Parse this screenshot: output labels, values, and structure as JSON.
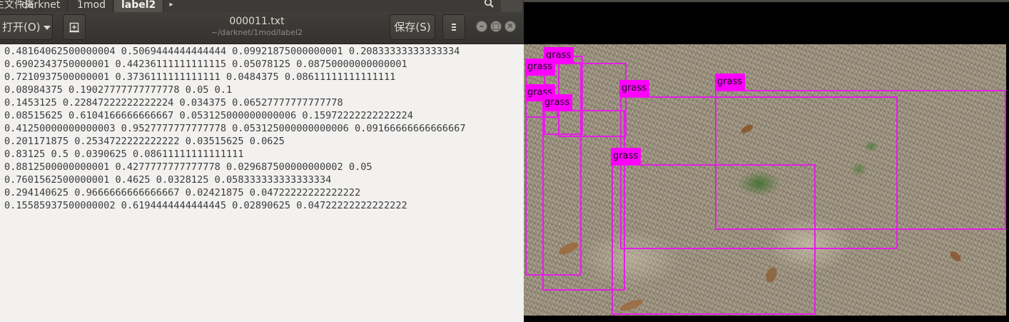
{
  "path_bar": {
    "crumbs": [
      "主文件夹",
      "darknet",
      "1mod",
      "label2"
    ],
    "next_arrow": "▸",
    "search_icon": "search-icon"
  },
  "toolbar": {
    "open_label": "打开(O)",
    "new_tab_icon": "new-document-icon",
    "save_label": "保存(S)",
    "menu_icon": "hamburger-menu-icon",
    "minimize_glyph": "–",
    "maximize_glyph": "□",
    "close_glyph": "✕"
  },
  "document": {
    "title": "000011.txt",
    "path": "~/darknet/1mod/label2",
    "lines": [
      "0.48164062500000004 0.5069444444444444 0.09921875000000001 0.20833333333333334",
      "0.6902343750000001 0.44236111111111115 0.05078125 0.08750000000000001",
      "0.7210937500000001 0.3736111111111111 0.0484375 0.08611111111111111",
      "0.08984375 0.19027777777777778 0.05 0.1",
      "0.1453125 0.22847222222222224 0.034375 0.06527777777777778",
      "0.08515625 0.6104166666666667 0.053125000000000006 0.15972222222222224",
      "0.41250000000000003 0.9527777777777778 0.053125000000000006 0.09166666666666667",
      "0.201171875 0.2534722222222222 0.03515625 0.0625",
      "0.83125 0.5 0.0390625 0.08611111111111111",
      "0.8812500000000001 0.4277777777777778 0.029687500000000002 0.05",
      "0.7601562500000001 0.4625 0.0328125 0.058333333333333334",
      "0.294140625 0.9666666666666667 0.02421875 0.04722222222222222",
      "0.15585937500000002 0.6194444444444445 0.02890625 0.04722222222222222"
    ]
  },
  "viewer": {
    "label_color": "#ff00ff",
    "detections": [
      "grass",
      "grass",
      "grass",
      "grass",
      "grass",
      "grass",
      "grass"
    ]
  }
}
